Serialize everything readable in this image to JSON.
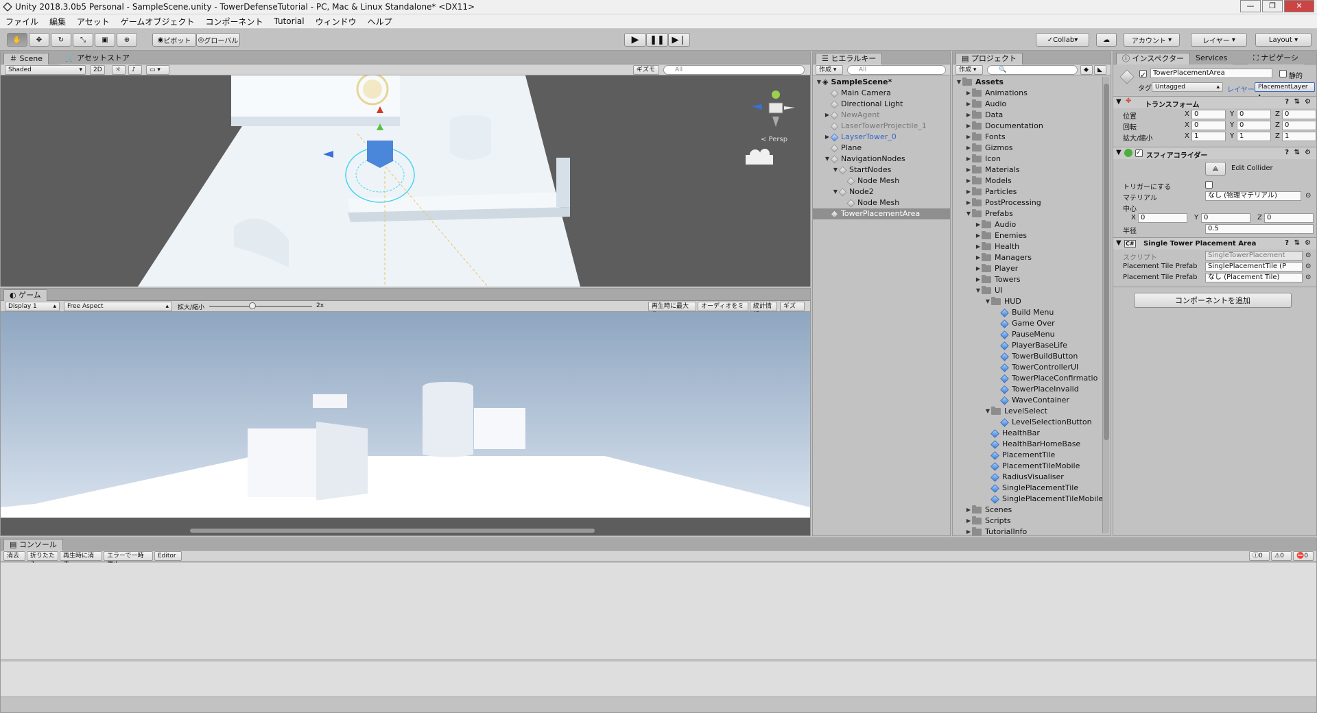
{
  "window": {
    "title": "Unity 2018.3.0b5 Personal - SampleScene.unity - TowerDefenseTutorial - PC, Mac & Linux Standalone* <DX11>"
  },
  "menu": [
    "ファイル",
    "編集",
    "アセット",
    "ゲームオブジェクト",
    "コンポーネント",
    "Tutorial",
    "ウィンドウ",
    "ヘルプ"
  ],
  "toolbar": {
    "pivot": "ピボット",
    "global": "グローバル",
    "collab": "Collab",
    "account": "アカウント",
    "layers": "レイヤー",
    "layout": "Layout"
  },
  "scene": {
    "tabs": [
      "Scene",
      "アセットストア"
    ],
    "shading": "Shaded",
    "mode2d": "2D",
    "gizmos": "ギズモ",
    "search": "All",
    "persp": "< Persp"
  },
  "game": {
    "tab": "ゲーム",
    "display": "Display 1",
    "aspect": "Free Aspect",
    "scale_label": "拡大/縮小",
    "scale_value": "2x",
    "maximize": "再生時に最大化",
    "mute": "オーディオをミュート",
    "stats": "統計情報",
    "gizmos": "ギズモ"
  },
  "hierarchy": {
    "tab": "ヒエラルキー",
    "create": "作成",
    "search": "All",
    "scene": "SampleScene*",
    "items": [
      {
        "label": "Main Camera",
        "depth": 1,
        "arrow": "",
        "style": ""
      },
      {
        "label": "Directional Light",
        "depth": 1,
        "arrow": "",
        "style": ""
      },
      {
        "label": "NewAgent",
        "depth": 1,
        "arrow": "▶",
        "style": "dim"
      },
      {
        "label": "LaserTowerProjectile_1",
        "depth": 1,
        "arrow": "",
        "style": "dim"
      },
      {
        "label": "LayserTower_0",
        "depth": 1,
        "arrow": "▶",
        "style": "bluet"
      },
      {
        "label": "Plane",
        "depth": 1,
        "arrow": "",
        "style": ""
      },
      {
        "label": "NavigationNodes",
        "depth": 1,
        "arrow": "▼",
        "style": ""
      },
      {
        "label": "StartNodes",
        "depth": 2,
        "arrow": "▼",
        "style": ""
      },
      {
        "label": "Node Mesh",
        "depth": 3,
        "arrow": "",
        "style": ""
      },
      {
        "label": "Node2",
        "depth": 2,
        "arrow": "▼",
        "style": ""
      },
      {
        "label": "Node Mesh",
        "depth": 3,
        "arrow": "",
        "style": ""
      },
      {
        "label": "TowerPlacementArea",
        "depth": 1,
        "arrow": "",
        "style": "sel"
      }
    ]
  },
  "project": {
    "tab": "プロジェクト",
    "create": "作成",
    "root": "Assets",
    "items": [
      {
        "label": "Animations",
        "depth": 1,
        "arrow": "▶",
        "type": "folder"
      },
      {
        "label": "Audio",
        "depth": 1,
        "arrow": "▶",
        "type": "folder"
      },
      {
        "label": "Data",
        "depth": 1,
        "arrow": "▶",
        "type": "folder"
      },
      {
        "label": "Documentation",
        "depth": 1,
        "arrow": "▶",
        "type": "folder"
      },
      {
        "label": "Fonts",
        "depth": 1,
        "arrow": "▶",
        "type": "folder"
      },
      {
        "label": "Gizmos",
        "depth": 1,
        "arrow": "▶",
        "type": "folder"
      },
      {
        "label": "Icon",
        "depth": 1,
        "arrow": "▶",
        "type": "folder"
      },
      {
        "label": "Materials",
        "depth": 1,
        "arrow": "▶",
        "type": "folder"
      },
      {
        "label": "Models",
        "depth": 1,
        "arrow": "▶",
        "type": "folder"
      },
      {
        "label": "Particles",
        "depth": 1,
        "arrow": "▶",
        "type": "folder"
      },
      {
        "label": "PostProcessing",
        "depth": 1,
        "arrow": "▶",
        "type": "folder"
      },
      {
        "label": "Prefabs",
        "depth": 1,
        "arrow": "▼",
        "type": "folder"
      },
      {
        "label": "Audio",
        "depth": 2,
        "arrow": "▶",
        "type": "folder"
      },
      {
        "label": "Enemies",
        "depth": 2,
        "arrow": "▶",
        "type": "folder"
      },
      {
        "label": "Health",
        "depth": 2,
        "arrow": "▶",
        "type": "folder"
      },
      {
        "label": "Managers",
        "depth": 2,
        "arrow": "▶",
        "type": "folder"
      },
      {
        "label": "Player",
        "depth": 2,
        "arrow": "▶",
        "type": "folder"
      },
      {
        "label": "Towers",
        "depth": 2,
        "arrow": "▶",
        "type": "folder"
      },
      {
        "label": "UI",
        "depth": 2,
        "arrow": "▼",
        "type": "folder"
      },
      {
        "label": "HUD",
        "depth": 3,
        "arrow": "▼",
        "type": "folder"
      },
      {
        "label": "Build Menu",
        "depth": 4,
        "arrow": "",
        "type": "prefab"
      },
      {
        "label": "Game Over",
        "depth": 4,
        "arrow": "",
        "type": "prefab"
      },
      {
        "label": "PauseMenu",
        "depth": 4,
        "arrow": "",
        "type": "prefab"
      },
      {
        "label": "PlayerBaseLife",
        "depth": 4,
        "arrow": "",
        "type": "prefab"
      },
      {
        "label": "TowerBuildButton",
        "depth": 4,
        "arrow": "",
        "type": "prefab"
      },
      {
        "label": "TowerControllerUI",
        "depth": 4,
        "arrow": "",
        "type": "prefab"
      },
      {
        "label": "TowerPlaceConfirmatio",
        "depth": 4,
        "arrow": "",
        "type": "prefab"
      },
      {
        "label": "TowerPlaceInvalid",
        "depth": 4,
        "arrow": "",
        "type": "prefab"
      },
      {
        "label": "WaveContainer",
        "depth": 4,
        "arrow": "",
        "type": "prefab"
      },
      {
        "label": "LevelSelect",
        "depth": 3,
        "arrow": "▼",
        "type": "folder"
      },
      {
        "label": "LevelSelectionButton",
        "depth": 4,
        "arrow": "",
        "type": "prefab"
      },
      {
        "label": "HealthBar",
        "depth": 3,
        "arrow": "",
        "type": "prefab"
      },
      {
        "label": "HealthBarHomeBase",
        "depth": 3,
        "arrow": "",
        "type": "prefab"
      },
      {
        "label": "PlacementTile",
        "depth": 3,
        "arrow": "",
        "type": "prefab"
      },
      {
        "label": "PlacementTileMobile",
        "depth": 3,
        "arrow": "",
        "type": "prefab"
      },
      {
        "label": "RadiusVisualiser",
        "depth": 3,
        "arrow": "",
        "type": "prefab"
      },
      {
        "label": "SinglePlacementTile",
        "depth": 3,
        "arrow": "",
        "type": "prefab"
      },
      {
        "label": "SinglePlacementTileMobile",
        "depth": 3,
        "arrow": "",
        "type": "prefab"
      },
      {
        "label": "Scenes",
        "depth": 1,
        "arrow": "▶",
        "type": "folder"
      },
      {
        "label": "Scripts",
        "depth": 1,
        "arrow": "▶",
        "type": "folder"
      },
      {
        "label": "TutorialInfo",
        "depth": 1,
        "arrow": "▶",
        "type": "folder"
      }
    ]
  },
  "inspector": {
    "tabs": [
      "インスペクター",
      "Services",
      "ナビゲーシ"
    ],
    "object_name": "TowerPlacementArea",
    "static": "静的",
    "tag_label": "タグ",
    "tag": "Untagged",
    "layer_label": "レイヤー",
    "layer": "PlacementLayer",
    "transform": {
      "title": "トランスフォーム",
      "rows": [
        {
          "label": "位置",
          "x": "0",
          "y": "0",
          "z": "0"
        },
        {
          "label": "回転",
          "x": "0",
          "y": "0",
          "z": "0"
        },
        {
          "label": "拡大/縮小",
          "x": "1",
          "y": "1",
          "z": "1"
        }
      ]
    },
    "sphere": {
      "title": "スフィアコライダー",
      "edit": "Edit Collider",
      "trigger": "トリガーにする",
      "material_label": "マテリアル",
      "material": "なし (物理マテリアル)",
      "center_label": "中心",
      "cx": "0",
      "cy": "0",
      "cz": "0",
      "radius_label": "半径",
      "radius": "0.5"
    },
    "script": {
      "title": "Single Tower Placement Area",
      "script_label": "スクリプト",
      "script": "SingleTowerPlacement",
      "p1_label": "Placement Tile Prefab",
      "p1": "SinglePlacementTile (P",
      "p2_label": "Placement Tile Prefab",
      "p2": "なし (Placement Tile)"
    },
    "add_component": "コンポーネントを追加"
  },
  "console": {
    "tab": "コンソール",
    "clear": "消去",
    "collapse": "折りたたみ",
    "clear_on_play": "再生時に消去",
    "error_pause": "エラーで一時停止",
    "editor": "Editor",
    "info": "0",
    "warn": "0",
    "error": "0"
  }
}
